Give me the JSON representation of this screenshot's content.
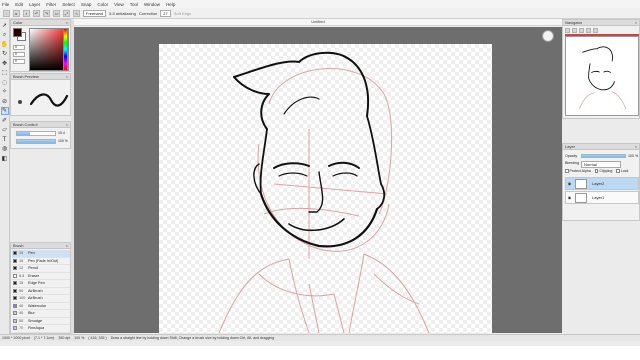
{
  "menu": [
    "File",
    "Edit",
    "Layer",
    "Filter",
    "Select",
    "Snap",
    "Color",
    "View",
    "Tool",
    "Window",
    "Help"
  ],
  "tool_options": {
    "stroke_mode": "Freehand",
    "antialiasing": "5.5 antialiasing",
    "correction_label": "Correction",
    "correction_value": "27",
    "soft_edge": "Soft Edge"
  },
  "document": {
    "title": "Untitled"
  },
  "tools": [
    "pointer-icon",
    "zoom-icon",
    "hand-icon",
    "rotate-icon",
    "move-icon",
    "select-rect-icon",
    "lasso-icon",
    "magic-wand-icon",
    "eyedropper-icon",
    "pen-icon",
    "brush-icon",
    "eraser-icon",
    "text-icon",
    "fill-icon",
    "gradient-icon"
  ],
  "color_panel": {
    "title": "Color",
    "foreground": "#2a0000",
    "background": "#ffffff",
    "fields": [
      "0",
      "0",
      "0"
    ]
  },
  "brush_preview": {
    "title": "Brush Preview"
  },
  "brush_control": {
    "title": "Brush Control",
    "size_value": "15.4",
    "size_fraction": 0.35,
    "opacity_value": "100 %",
    "opacity_fraction": 1.0
  },
  "brush_panel": {
    "title": "Brush",
    "items": [
      {
        "size": "15",
        "name": "Pen",
        "color": "#222222",
        "selected": true
      },
      {
        "size": "15",
        "name": "Pen (Fade In/Out)",
        "color": "#222222",
        "selected": false
      },
      {
        "size": "12",
        "name": "Pencil",
        "color": "#222222",
        "selected": false
      },
      {
        "size": "6.5",
        "name": "Eraser",
        "color": "#ffffff",
        "selected": false
      },
      {
        "size": "15",
        "name": "Edge Pen",
        "color": "#222222",
        "selected": false
      },
      {
        "size": "50",
        "name": "AirBrush",
        "color": "#222222",
        "selected": false
      },
      {
        "size": "100",
        "name": "AirBrush",
        "color": "#222222",
        "selected": false
      },
      {
        "size": "40",
        "name": "Watercolor",
        "color": "#7f7fff",
        "selected": false
      },
      {
        "size": "40",
        "name": "Blur",
        "color": "#cccccc",
        "selected": false
      },
      {
        "size": "50",
        "name": "Smudge",
        "color": "#cccccc",
        "selected": false
      },
      {
        "size": "70",
        "name": "FineAqua",
        "color": "#bfbfff",
        "selected": false
      }
    ]
  },
  "status_bar": {
    "size": "1000 * 1000 pixel",
    "cm": "(7.1 * 7.1cm)",
    "dpi": "350 dpi",
    "zoom": "100 %",
    "coords": "( 416, 335 )",
    "hint": "Draw a straight line by holding down Shift, Change a brush size by holding down Ctrl, Alt, and dragging"
  },
  "navigator": {
    "title": "Navigator"
  },
  "layer_panel": {
    "title": "Layer",
    "opacity_label": "Opacity",
    "opacity_value": "100 %",
    "blending_label": "Blending",
    "blending_value": "Normal",
    "protect_alpha": "Protect Alpha",
    "clipping": "Clipping",
    "lock": "Lock",
    "layers": [
      {
        "name": "Layer2",
        "selected": true
      },
      {
        "name": "Layer1",
        "selected": false
      }
    ]
  },
  "colors": {
    "sketch": "#d99a9a",
    "ink": "#111111",
    "accent": "#7fb3e6"
  }
}
